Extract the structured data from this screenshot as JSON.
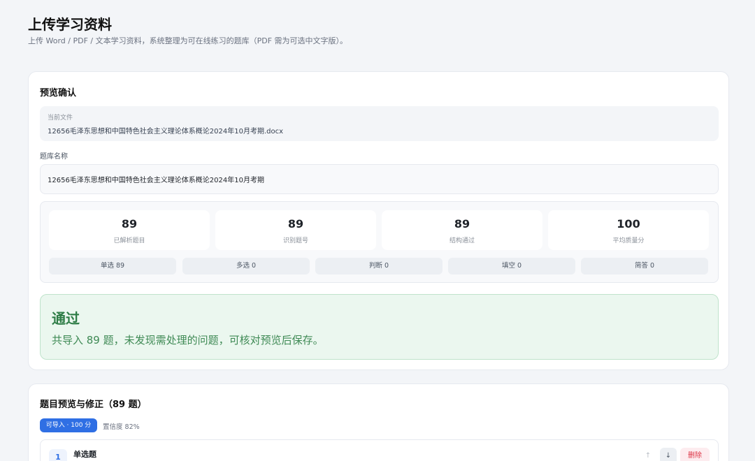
{
  "page": {
    "title": "上传学习资料",
    "subtitle": "上传 Word / PDF / 文本学习资料，系统整理为可在线练习的题库（PDF 需为可选中文字版）。"
  },
  "preview": {
    "title": "预览确认",
    "file_label": "当前文件",
    "file_name": "12656毛泽东思想和中国特色社会主义理论体系概论2024年10月考期.docx",
    "bank_label": "题库名称",
    "bank_name": "12656毛泽东思想和中国特色社会主义理论体系概论2024年10月考期",
    "stats": [
      {
        "value": "89",
        "label": "已解析题目"
      },
      {
        "value": "89",
        "label": "识别题号"
      },
      {
        "value": "89",
        "label": "结构通过"
      },
      {
        "value": "100",
        "label": "平均质量分"
      }
    ],
    "types": [
      "单选 89",
      "多选 0",
      "判断 0",
      "填空 0",
      "简答 0"
    ],
    "result_title": "通过",
    "result_desc": "共导入 89 题，未发现需处理的问题，可核对预览后保存。"
  },
  "questions": {
    "title": "题目预览与修正（89 题）",
    "status_chip": "可导入 · 100 分",
    "confidence": "置信度 82%",
    "first_item": {
      "number": "1",
      "type": "单选题",
      "subtitle": "",
      "move_up": "↑",
      "move_down": "↓",
      "delete": "删除"
    }
  },
  "colors": {
    "accent": "#2f6fe4",
    "success_bg": "#ebf7ef",
    "success_text": "#2f7d47",
    "danger": "#dc3546"
  }
}
